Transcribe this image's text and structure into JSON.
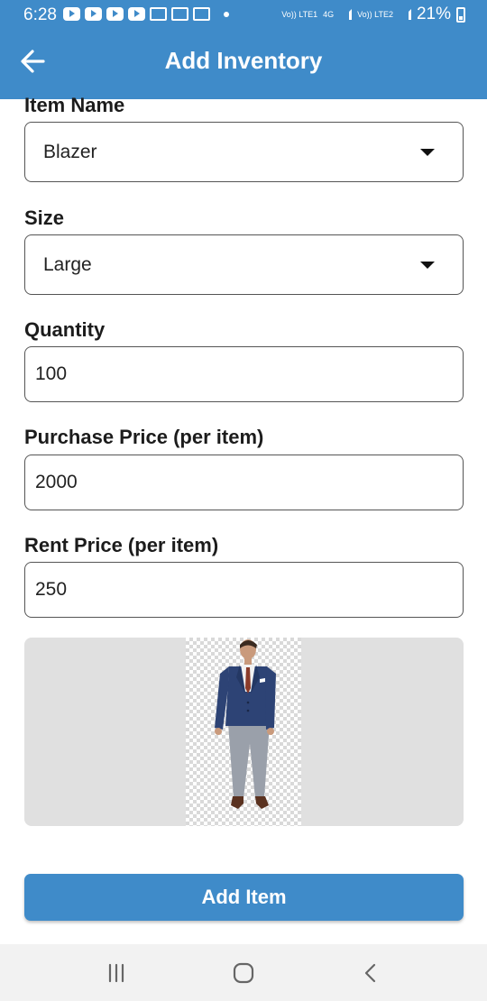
{
  "status_bar": {
    "time": "6:28",
    "battery": "21%",
    "network_1": "Vo)) LTE1",
    "network_type": "4G",
    "network_2": "Vo)) LTE2"
  },
  "app_bar": {
    "title": "Add Inventory",
    "back_icon": "arrow-left-icon"
  },
  "form": {
    "item_name": {
      "label": "Item Name",
      "value": "Blazer"
    },
    "size": {
      "label": "Size",
      "value": "Large"
    },
    "quantity": {
      "label": "Quantity",
      "value": "100"
    },
    "purchase_price": {
      "label": "Purchase Price (per item)",
      "value": "2000"
    },
    "rent_price": {
      "label": "Rent Price (per item)",
      "value": "250"
    }
  },
  "image": {
    "icon": "blazer-product-image"
  },
  "add_button": {
    "label": "Add Item"
  },
  "nav_bar": {
    "recent_icon": "recent-apps-icon",
    "home_icon": "home-icon",
    "back_icon": "back-chevron-icon"
  },
  "colors": {
    "primary": "#3f8bc9",
    "image_bg": "#e0e0e0",
    "nav_bg": "#f2f2f2"
  }
}
